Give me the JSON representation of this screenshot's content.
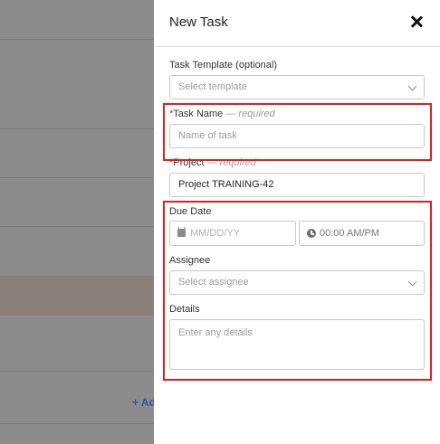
{
  "background": {
    "add_link": "+ Ad"
  },
  "panel": {
    "title": "New Task",
    "close_icon": "close-icon"
  },
  "form": {
    "template": {
      "label": "Task Template (optional)",
      "placeholder": "Select template"
    },
    "task_name": {
      "star": "*",
      "label": "Task Name",
      "hint": "— required",
      "placeholder": "Name of task"
    },
    "project": {
      "star": "*",
      "label": "Project",
      "hint": "— required",
      "value": "Project TRAINING-42"
    },
    "due_date": {
      "label": "Due Date",
      "date_placeholder": "MM/DD/YY",
      "time_placeholder": "00:00 AM/PM",
      "date_icon": "calendar-icon",
      "time_icon": "clock-icon"
    },
    "assignee": {
      "label": "Assignee",
      "placeholder": "Select assignee"
    },
    "details": {
      "label": "Details",
      "placeholder": "Enter any details"
    }
  },
  "colors": {
    "highlight": "#e0201f",
    "required_star": "#d42424",
    "link": "#2d55a8"
  }
}
